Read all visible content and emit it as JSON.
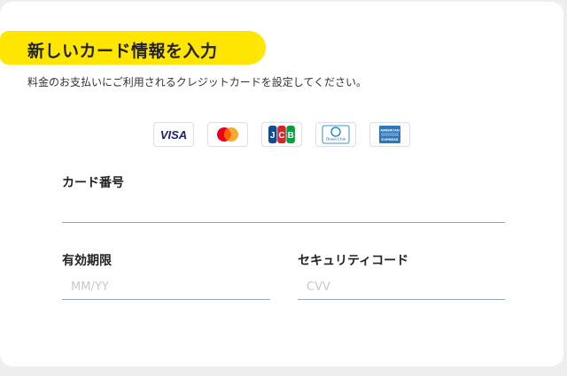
{
  "form": {
    "title": "新しいカード情報を入力",
    "subtitle": "料金のお支払いにご利用されるクレジットカードを設定してください。",
    "card_brands": [
      {
        "name": "VISA",
        "icon": "visa-icon"
      },
      {
        "name": "Mastercard",
        "icon": "mastercard-icon"
      },
      {
        "name": "JCB",
        "icon": "jcb-icon"
      },
      {
        "name": "Diners Club",
        "icon": "diners-club-icon"
      },
      {
        "name": "American Express",
        "icon": "amex-icon"
      }
    ],
    "card_number": {
      "label": "カード番号",
      "value": "",
      "placeholder": ""
    },
    "expiry": {
      "label": "有効期限",
      "value": "",
      "placeholder": "MM/YY"
    },
    "cvv": {
      "label": "セキュリティコード",
      "value": "",
      "placeholder": "CVV"
    }
  },
  "colors": {
    "accent_yellow": "#ffe600",
    "input_underline": "#8fa3c4",
    "visa_blue": "#1a1f71",
    "mastercard_red": "#eb001b",
    "mastercard_orange": "#f79e1b",
    "amex_blue": "#2e77bc"
  }
}
